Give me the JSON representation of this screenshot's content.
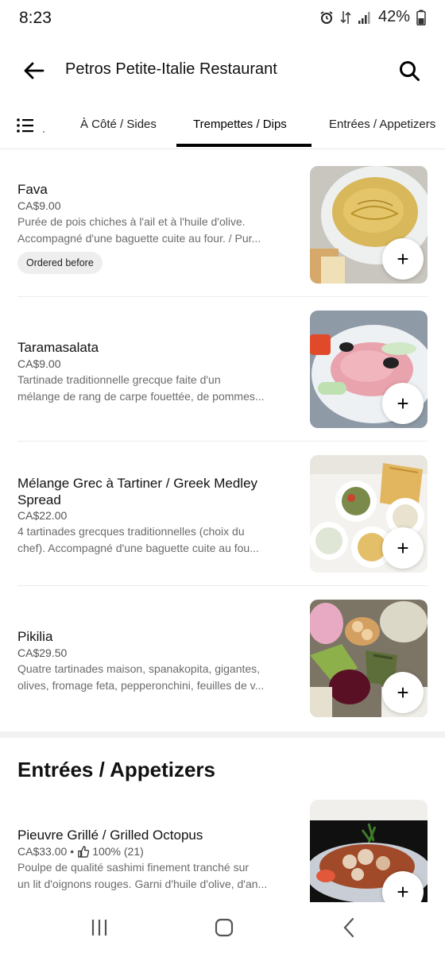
{
  "status": {
    "time": "8:23",
    "battery": "42%"
  },
  "header": {
    "title": "Petros Petite-Italie Restaurant"
  },
  "tabs": [
    {
      "label": "À Côté / Sides"
    },
    {
      "label": "Trempettes / Dips"
    },
    {
      "label": "Entrées / Appetizers"
    }
  ],
  "items": [
    {
      "name": "Fava",
      "price": "CA$9.00",
      "desc1": "Purée de pois chiches à l'ail et à l'huile d'olive.",
      "desc2": "Accompagné d'une baguette cuite au four. / Pur...",
      "badge": "Ordered before",
      "add": "+"
    },
    {
      "name": "Taramasalata",
      "price": "CA$9.00",
      "desc1": "Tartinade traditionnelle grecque faite d'un",
      "desc2": "mélange de rang de carpe fouettée, de pommes...",
      "add": "+"
    },
    {
      "name": "Mélange Grec à Tartiner / Greek Medley Spread",
      "price": "CA$22.00",
      "desc1": "4 tartinades grecques traditionnelles (choix du",
      "desc2": "chef). Accompagné d'une baguette cuite au fou...",
      "add": "+"
    },
    {
      "name": "Pikilia",
      "price": "CA$29.50",
      "desc1": "Quatre tartinades maison, spanakopita, gigantes,",
      "desc2": "olives, fromage feta, pepperonchini, feuilles de v...",
      "add": "+"
    }
  ],
  "section": {
    "title": "Entrées / Appetizers"
  },
  "appetizer": {
    "name": "Pieuvre Grillé / Grilled Octopus",
    "price": "CA$33.00",
    "rating": "100% (21)",
    "desc1": "Poulpe de qualité sashimi finement tranché sur",
    "desc2": "un lit d'oignons rouges. Garni d'huile d'olive, d'an...",
    "add": "+"
  }
}
